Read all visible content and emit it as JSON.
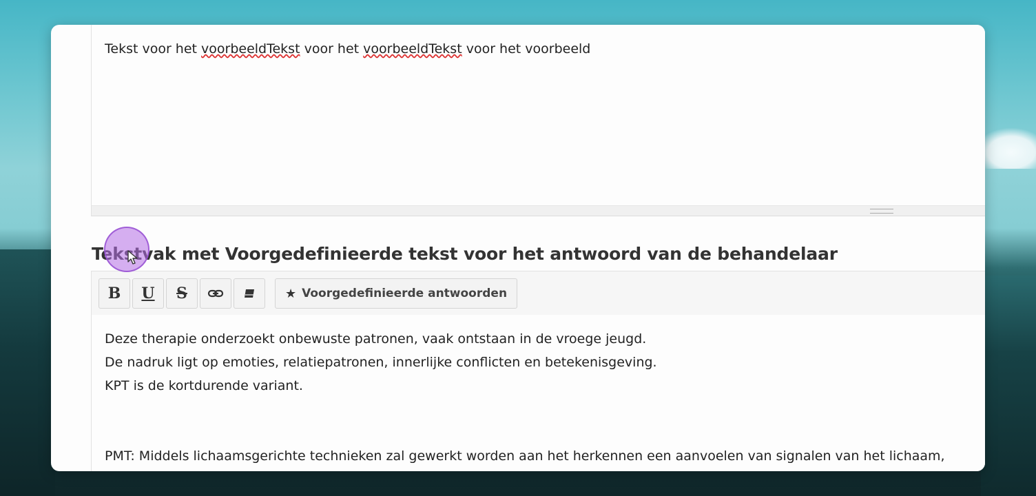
{
  "top_editor": {
    "segments": [
      {
        "text": "Tekst voor het ",
        "misspelled": false
      },
      {
        "text": "voorbeeldTekst",
        "misspelled": true
      },
      {
        "text": " voor het ",
        "misspelled": false
      },
      {
        "text": "voorbeeldTekst",
        "misspelled": true
      },
      {
        "text": " voor het voorbeeld",
        "misspelled": false
      }
    ]
  },
  "section": {
    "title": "Tekstvak met Voorgedefinieerde tekst voor het antwoord van de behandelaar"
  },
  "toolbar": {
    "bold_label": "B",
    "underline_label": "U",
    "strike_label": "S",
    "predefined_label": "Voorgedefinieerde antwoorden",
    "icons": [
      "bold-icon",
      "underline-icon",
      "strikethrough-icon",
      "link-icon",
      "eraser-icon",
      "star-icon"
    ]
  },
  "answer_editor": {
    "lines": [
      "Deze therapie onderzoekt onbewuste patronen, vaak ontstaan in de vroege jeugd.",
      "De nadruk ligt op emoties, relatiepatronen, innerlijke conflicten en betekenisgeving.",
      "KPT is de kortdurende variant.",
      "",
      "PMT: Middels lichaamsgerichte technieken zal gewerkt worden aan het herkennen een aanvoelen van signalen van het lichaam,"
    ]
  }
}
